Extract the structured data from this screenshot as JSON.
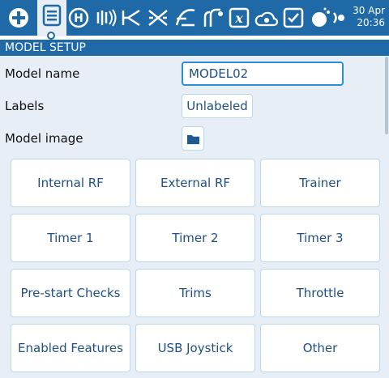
{
  "topbar": {
    "icons": [
      "radio-menu-icon",
      "model-setup-icon",
      "heli-icon",
      "mixer-icon",
      "inputs-icon",
      "outputs-icon",
      "curves-icon",
      "logical-switches-icon",
      "lua-scripts-icon",
      "telemetry-icon",
      "checklist-icon",
      "theme-icon",
      "volume-icon"
    ],
    "date": "30 Apr",
    "time": "20:36"
  },
  "section": {
    "title": "MODEL SETUP"
  },
  "fields": {
    "model_name_label": "Model name",
    "model_name_value": "MODEL02",
    "labels_label": "Labels",
    "labels_value": "Unlabeled",
    "model_image_label": "Model image"
  },
  "buttons": [
    "Internal RF",
    "External RF",
    "Trainer",
    "Timer 1",
    "Timer 2",
    "Timer 3",
    "Pre-start Checks",
    "Trims",
    "Throttle",
    "Enabled Features",
    "USB Joystick",
    "Other"
  ],
  "colors": {
    "header_blue": "#1f6aa6",
    "content_bg": "#e7eef6",
    "text_blue": "#1f4f83",
    "focus_border": "#2a8fd6"
  }
}
